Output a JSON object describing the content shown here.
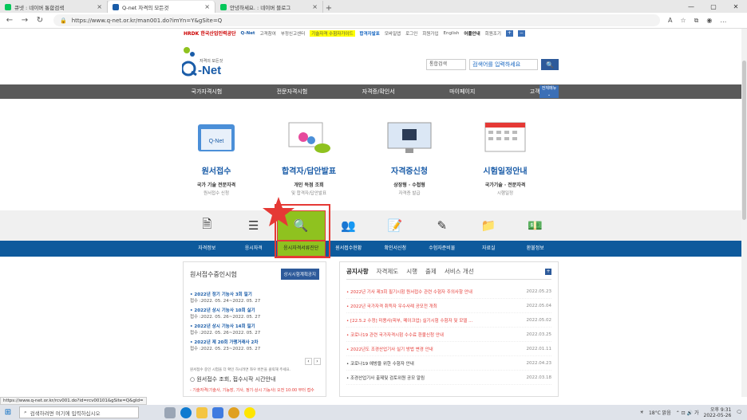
{
  "browser": {
    "tabs": [
      {
        "title": "큐넷 : 네이버 통합검색",
        "color": "#03c75a"
      },
      {
        "title": "Q-net 자격의 모든것",
        "color": "#1a5ca8"
      },
      {
        "title": "안녕하세요. : 네이버 블로그",
        "color": "#03c75a"
      }
    ],
    "new_tab": "+",
    "url": "https://www.q-net.or.kr/man001.do?imYn=Y&gSite=Q"
  },
  "util": {
    "hrdk": "HRDK 한국산업인력공단",
    "qnet": "Q-Net",
    "links": [
      "고객참여",
      "부정신고센터"
    ],
    "highlight": "기술자격 수험자가이드",
    "pass": "합격자발표",
    "links2": [
      "모바일앱",
      "로그인",
      "회원가입",
      "English",
      "어플안내",
      "회원조기"
    ]
  },
  "logo": {
    "tagline": "자격의 모든것",
    "brand": "Net"
  },
  "search": {
    "select": "통합검색",
    "placeholder": "검색어를 입력하세요"
  },
  "gnb": {
    "items": [
      "국가자격시험",
      "전문자격시험",
      "자격증/확인서",
      "마이페이지",
      "고객지원"
    ],
    "all": "전체메뉴"
  },
  "features": [
    {
      "title": "원서접수",
      "sub1": "국가 기술 전문자격",
      "sub2": "원서접수 신청"
    },
    {
      "title": "합격자/답안발표",
      "sub1": "개인 득점 조회",
      "sub2": "및 합격자/답안발표"
    },
    {
      "title": "자격증신청",
      "sub1": "상장형 · 수첩형",
      "sub2": "자격증 발급"
    },
    {
      "title": "시험일정안내",
      "sub1": "국가기술 · 전문자격",
      "sub2": "시행일정"
    }
  ],
  "quick": {
    "icons": [
      "document-icon",
      "list-icon",
      "search-icon",
      "people-icon",
      "form-icon",
      "pen-icon",
      "folder-icon",
      "money-icon"
    ],
    "labels": [
      "자격정보",
      "응시자격",
      "응시자격서류진단",
      "원서접수현황",
      "확인서신청",
      "수험자준비물",
      "자료실",
      "환불정보"
    ]
  },
  "left": {
    "title": "원서접수중인시험",
    "button": "상시시험계획공지",
    "items": [
      {
        "title": "• 2022년 정기 기능사 3회 필기",
        "dates": "접수 :2022. 05. 24~2022. 05. 27"
      },
      {
        "title": "• 2022년 상시 기능사 10회 실기",
        "dates": "접수 :2022. 05. 26~2022. 05. 27"
      },
      {
        "title": "• 2022년 상시 기능사 14회 필기",
        "dates": "접수 :2022. 05. 26~2022. 05. 27"
      },
      {
        "title": "• 2022년 제 20회 가맹거래사 2차",
        "dates": "접수 :2022. 05. 23~2022. 05. 27"
      }
    ],
    "note": "원서접수 중인 시험을 더 확인 하시려면 좌우 버튼을 클릭해 주세요.",
    "radio": "○ 원서접수 조회, 접수시작 시간안내",
    "warning": "- 기술자격(기술사, 기능장, 기사, 정기·상시 기능사) 오전 10:00 부터 접수"
  },
  "right": {
    "tabs": [
      "공지사항",
      "자격제도",
      "시행",
      "출제",
      "서비스 개선"
    ],
    "news": [
      {
        "title": "• 2022년 기사 제3회 필기시험 원서접수 관련 수험자 주의사항 안내",
        "date": "2022.05.23",
        "red": true
      },
      {
        "title": "• 2022년 국가자격 취득자 우수사례 공모전 개최",
        "date": "2022.05.04",
        "red": true
      },
      {
        "title": "• [22.5.2 수정] 미용사(피부, 메이크업) 실기시험 수험자 및 모델 ...",
        "date": "2022.05.02",
        "red": true
      },
      {
        "title": "• 코로나19 관련 국가자격시험 수수료 환불신청 안내",
        "date": "2022.03.25",
        "red": true
      },
      {
        "title": "• 2022년도 조경산업기사 실기 방법 변경 안내",
        "date": "2022.01.11",
        "red": true
      },
      {
        "title": "• 코로나19 예방을 위한 수험자 안내",
        "date": "2022.04.23",
        "red": false
      },
      {
        "title": "• 조경산업기사 출제및 검토위원 공모 알림",
        "date": "2022.03.18",
        "red": false
      }
    ]
  },
  "statusbar": {
    "url": "https://www.q-net.or.kr/rcv001.do?id=rcv00101&gSite=Q&gId="
  },
  "taskbar": {
    "search": "검색하려면 여기에 입력하십시오",
    "weather": "18°C 맑음",
    "time": "오후 9:31",
    "date": "2022-05-26"
  }
}
